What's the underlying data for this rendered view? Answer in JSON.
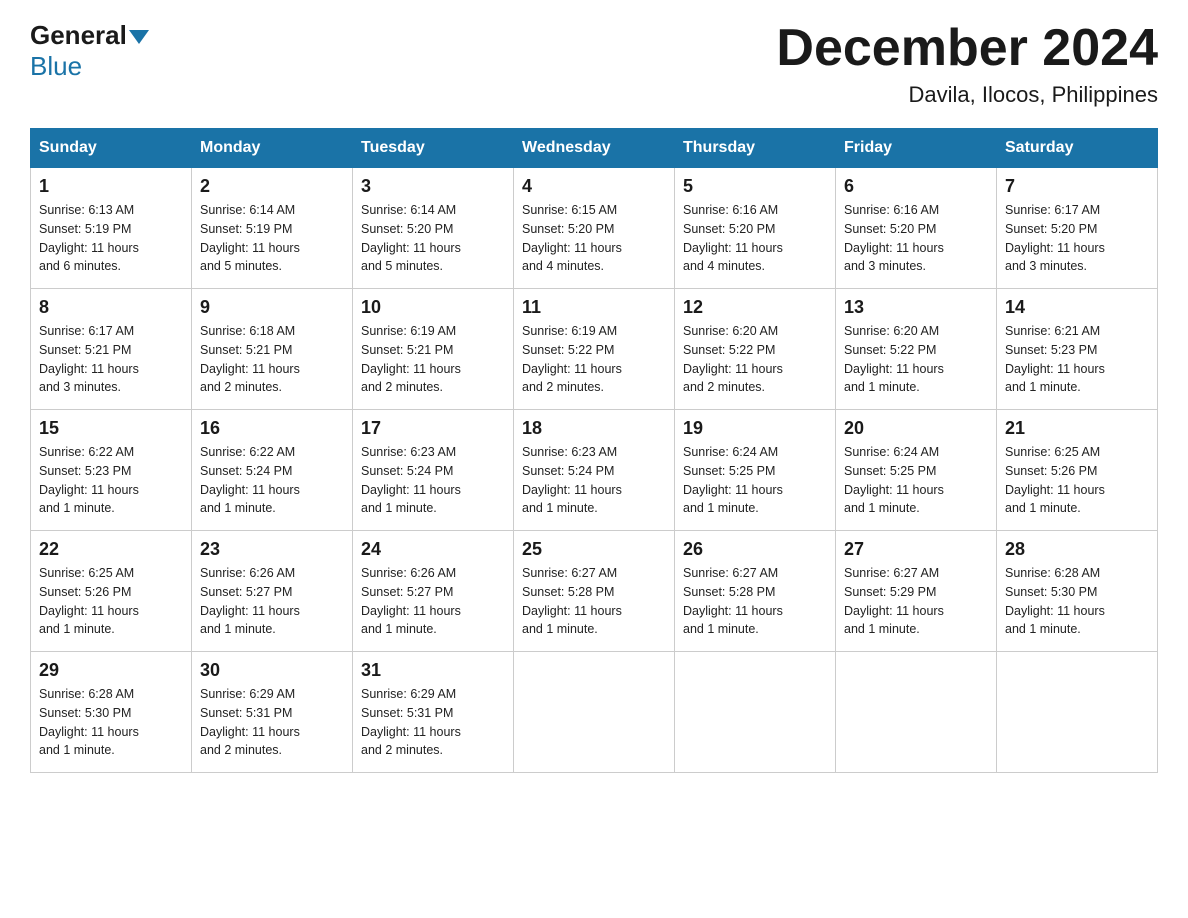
{
  "header": {
    "logo_general": "General",
    "logo_blue": "Blue",
    "month_title": "December 2024",
    "location": "Davila, Ilocos, Philippines"
  },
  "weekdays": [
    "Sunday",
    "Monday",
    "Tuesday",
    "Wednesday",
    "Thursday",
    "Friday",
    "Saturday"
  ],
  "weeks": [
    [
      {
        "day": "1",
        "sunrise": "6:13 AM",
        "sunset": "5:19 PM",
        "daylight": "11 hours and 6 minutes."
      },
      {
        "day": "2",
        "sunrise": "6:14 AM",
        "sunset": "5:19 PM",
        "daylight": "11 hours and 5 minutes."
      },
      {
        "day": "3",
        "sunrise": "6:14 AM",
        "sunset": "5:20 PM",
        "daylight": "11 hours and 5 minutes."
      },
      {
        "day": "4",
        "sunrise": "6:15 AM",
        "sunset": "5:20 PM",
        "daylight": "11 hours and 4 minutes."
      },
      {
        "day": "5",
        "sunrise": "6:16 AM",
        "sunset": "5:20 PM",
        "daylight": "11 hours and 4 minutes."
      },
      {
        "day": "6",
        "sunrise": "6:16 AM",
        "sunset": "5:20 PM",
        "daylight": "11 hours and 3 minutes."
      },
      {
        "day": "7",
        "sunrise": "6:17 AM",
        "sunset": "5:20 PM",
        "daylight": "11 hours and 3 minutes."
      }
    ],
    [
      {
        "day": "8",
        "sunrise": "6:17 AM",
        "sunset": "5:21 PM",
        "daylight": "11 hours and 3 minutes."
      },
      {
        "day": "9",
        "sunrise": "6:18 AM",
        "sunset": "5:21 PM",
        "daylight": "11 hours and 2 minutes."
      },
      {
        "day": "10",
        "sunrise": "6:19 AM",
        "sunset": "5:21 PM",
        "daylight": "11 hours and 2 minutes."
      },
      {
        "day": "11",
        "sunrise": "6:19 AM",
        "sunset": "5:22 PM",
        "daylight": "11 hours and 2 minutes."
      },
      {
        "day": "12",
        "sunrise": "6:20 AM",
        "sunset": "5:22 PM",
        "daylight": "11 hours and 2 minutes."
      },
      {
        "day": "13",
        "sunrise": "6:20 AM",
        "sunset": "5:22 PM",
        "daylight": "11 hours and 1 minute."
      },
      {
        "day": "14",
        "sunrise": "6:21 AM",
        "sunset": "5:23 PM",
        "daylight": "11 hours and 1 minute."
      }
    ],
    [
      {
        "day": "15",
        "sunrise": "6:22 AM",
        "sunset": "5:23 PM",
        "daylight": "11 hours and 1 minute."
      },
      {
        "day": "16",
        "sunrise": "6:22 AM",
        "sunset": "5:24 PM",
        "daylight": "11 hours and 1 minute."
      },
      {
        "day": "17",
        "sunrise": "6:23 AM",
        "sunset": "5:24 PM",
        "daylight": "11 hours and 1 minute."
      },
      {
        "day": "18",
        "sunrise": "6:23 AM",
        "sunset": "5:24 PM",
        "daylight": "11 hours and 1 minute."
      },
      {
        "day": "19",
        "sunrise": "6:24 AM",
        "sunset": "5:25 PM",
        "daylight": "11 hours and 1 minute."
      },
      {
        "day": "20",
        "sunrise": "6:24 AM",
        "sunset": "5:25 PM",
        "daylight": "11 hours and 1 minute."
      },
      {
        "day": "21",
        "sunrise": "6:25 AM",
        "sunset": "5:26 PM",
        "daylight": "11 hours and 1 minute."
      }
    ],
    [
      {
        "day": "22",
        "sunrise": "6:25 AM",
        "sunset": "5:26 PM",
        "daylight": "11 hours and 1 minute."
      },
      {
        "day": "23",
        "sunrise": "6:26 AM",
        "sunset": "5:27 PM",
        "daylight": "11 hours and 1 minute."
      },
      {
        "day": "24",
        "sunrise": "6:26 AM",
        "sunset": "5:27 PM",
        "daylight": "11 hours and 1 minute."
      },
      {
        "day": "25",
        "sunrise": "6:27 AM",
        "sunset": "5:28 PM",
        "daylight": "11 hours and 1 minute."
      },
      {
        "day": "26",
        "sunrise": "6:27 AM",
        "sunset": "5:28 PM",
        "daylight": "11 hours and 1 minute."
      },
      {
        "day": "27",
        "sunrise": "6:27 AM",
        "sunset": "5:29 PM",
        "daylight": "11 hours and 1 minute."
      },
      {
        "day": "28",
        "sunrise": "6:28 AM",
        "sunset": "5:30 PM",
        "daylight": "11 hours and 1 minute."
      }
    ],
    [
      {
        "day": "29",
        "sunrise": "6:28 AM",
        "sunset": "5:30 PM",
        "daylight": "11 hours and 1 minute."
      },
      {
        "day": "30",
        "sunrise": "6:29 AM",
        "sunset": "5:31 PM",
        "daylight": "11 hours and 2 minutes."
      },
      {
        "day": "31",
        "sunrise": "6:29 AM",
        "sunset": "5:31 PM",
        "daylight": "11 hours and 2 minutes."
      },
      null,
      null,
      null,
      null
    ]
  ],
  "labels": {
    "sunrise": "Sunrise:",
    "sunset": "Sunset:",
    "daylight": "Daylight:"
  }
}
